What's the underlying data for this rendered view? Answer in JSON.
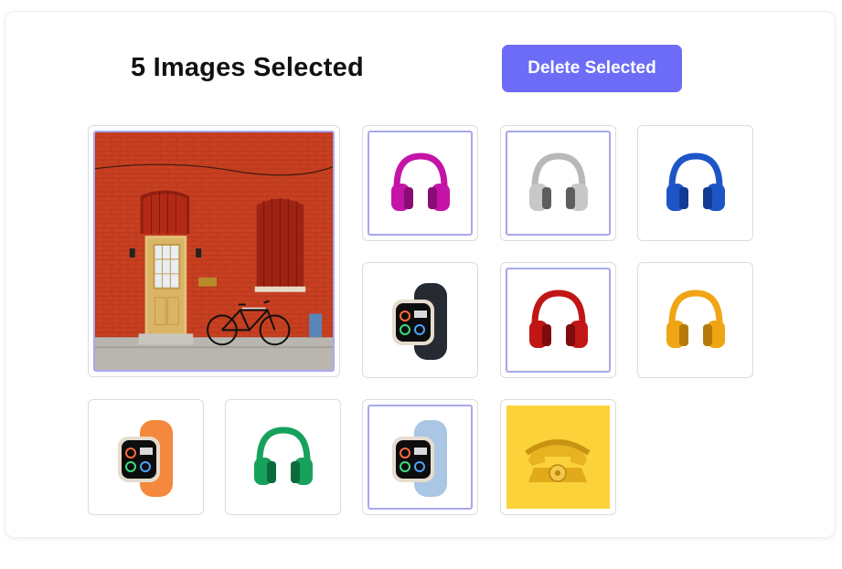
{
  "header": {
    "title": "5 Images Selected",
    "delete_label": "Delete Selected"
  },
  "colors": {
    "accent": "#6c6cf7",
    "selected_border": "#a8a8ec"
  },
  "gallery": [
    {
      "item": "brick-wall-bicycle-photo",
      "selected": true
    },
    {
      "item": "headphones-magenta-icon",
      "color": "#c414a8",
      "selected": true
    },
    {
      "item": "headphones-gray-icon",
      "color": "#a7a7a7",
      "selected": true
    },
    {
      "item": "headphones-blue-icon",
      "color": "#1d55c7",
      "selected": false
    },
    {
      "item": "smartwatch-black-icon",
      "color": "#262a33",
      "selected": false
    },
    {
      "item": "headphones-red-icon",
      "color": "#c11616",
      "selected": true
    },
    {
      "item": "headphones-orange-icon",
      "color": "#efa514",
      "selected": false
    },
    {
      "item": "smartwatch-orange-icon",
      "color": "#f4883c",
      "selected": false
    },
    {
      "item": "headphones-green-icon",
      "color": "#17a25c",
      "selected": false
    },
    {
      "item": "smartwatch-lightblue-icon",
      "color": "#a9c6e4",
      "selected": true
    },
    {
      "item": "yellow-phone-photo",
      "color": "#fcd23a",
      "selected": false
    }
  ]
}
